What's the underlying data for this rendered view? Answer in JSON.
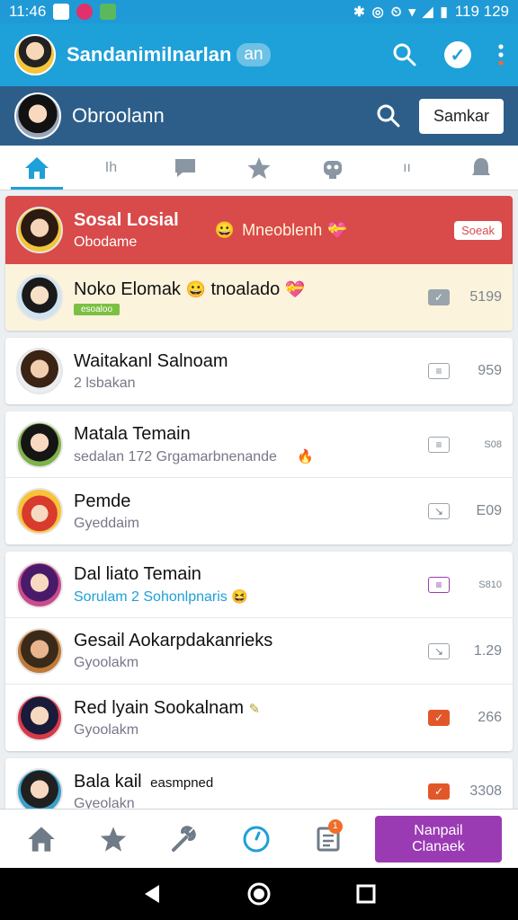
{
  "status_bar": {
    "time": "11:46",
    "right_text": "119 129"
  },
  "app_bar": {
    "title": "Sandanimilnarlan",
    "pill": "an"
  },
  "sub_header": {
    "title": "Obroolann",
    "button_label": "Samkar"
  },
  "tabs": [
    {
      "icon": "home-icon"
    },
    {
      "label": "Ih"
    },
    {
      "icon": "chat-icon"
    },
    {
      "icon": "star-icon"
    },
    {
      "icon": "robot-icon"
    },
    {
      "label": "ıı"
    },
    {
      "icon": "bell-icon"
    }
  ],
  "featured": {
    "name": "Sosal Losial",
    "sub": "Obodame",
    "middle": "Mneoblenh",
    "button_label": "Soeak"
  },
  "rows": [
    {
      "name": "Noko Elomak",
      "name_suffix": "tnoalado",
      "badge": "esoaloo",
      "count": "5199"
    },
    {
      "name": "Waitakanl Salnoam",
      "sub": "2 lsbakan",
      "count": "959"
    },
    {
      "name": "Matala Temain",
      "sub": "sedalan 172 Grgamarbnenande",
      "count": "S08"
    },
    {
      "name": "Pemde",
      "sub": "Gyeddaim",
      "count": "E09"
    },
    {
      "name": "Dal liato Temain",
      "sub": "Sorulam 2 Sohonlpnaris",
      "count": "S810"
    },
    {
      "name": "Gesail Aokarpdakanrieks",
      "sub": "Gyoolakm",
      "count": "1.29"
    },
    {
      "name": "Red lyain Sookalnam",
      "sub": "Gyoolakm",
      "count": "266"
    },
    {
      "name": "Bala kail",
      "name_suffix": "easmpned",
      "sub": "Gyeolakn",
      "count": "3308"
    }
  ],
  "bottom_nav": {
    "notif_count": "1",
    "cta_label": "Nanpail Clanaek"
  },
  "colors": {
    "primary": "#1ea0d8",
    "header": "#2d5e8a",
    "featured": "#d94a4a",
    "accent": "#9b3bb3",
    "warning": "#e2572a"
  }
}
